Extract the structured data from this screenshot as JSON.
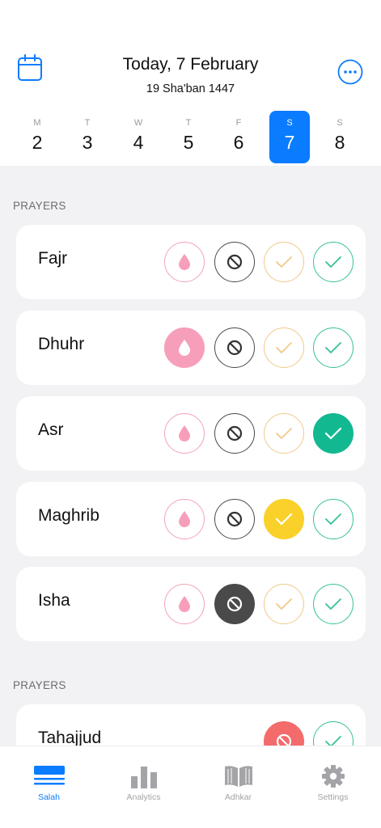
{
  "header": {
    "title": "Today, 7 February",
    "subtitle": "19 Sha'ban 1447",
    "calendar_icon": "calendar-icon",
    "more_icon": "ellipsis-circle-icon",
    "accent": "#0a7cff"
  },
  "days": [
    {
      "dow": "M",
      "num": "2",
      "selected": false
    },
    {
      "dow": "T",
      "num": "3",
      "selected": false
    },
    {
      "dow": "W",
      "num": "4",
      "selected": false
    },
    {
      "dow": "T",
      "num": "5",
      "selected": false
    },
    {
      "dow": "F",
      "num": "6",
      "selected": false
    },
    {
      "dow": "S",
      "num": "7",
      "selected": true
    },
    {
      "dow": "S",
      "num": "8",
      "selected": false
    }
  ],
  "sections": [
    {
      "label": "PRAYERS"
    },
    {
      "label": "PRAYERS"
    }
  ],
  "prayers": [
    {
      "name": "Fajr",
      "status": "none"
    },
    {
      "name": "Dhuhr",
      "status": "menses"
    },
    {
      "name": "Asr",
      "status": "on-time"
    },
    {
      "name": "Maghrib",
      "status": "late"
    },
    {
      "name": "Isha",
      "status": "missed"
    }
  ],
  "extra_prayers": [
    {
      "name": "Tahajjud",
      "status": "missed"
    }
  ],
  "status_colors": {
    "menses": "#f79fba",
    "missed": "#4a4a4a",
    "late": "#f9d12a",
    "on_time": "#12b890",
    "missed_extra": "#f46b6b"
  },
  "tabs": [
    {
      "label": "Salah",
      "icon": "salah-icon",
      "active": true
    },
    {
      "label": "Analytics",
      "icon": "bar-chart-icon",
      "active": false
    },
    {
      "label": "Adhkar",
      "icon": "book-icon",
      "active": false
    },
    {
      "label": "Settings",
      "icon": "gear-icon",
      "active": false
    }
  ]
}
